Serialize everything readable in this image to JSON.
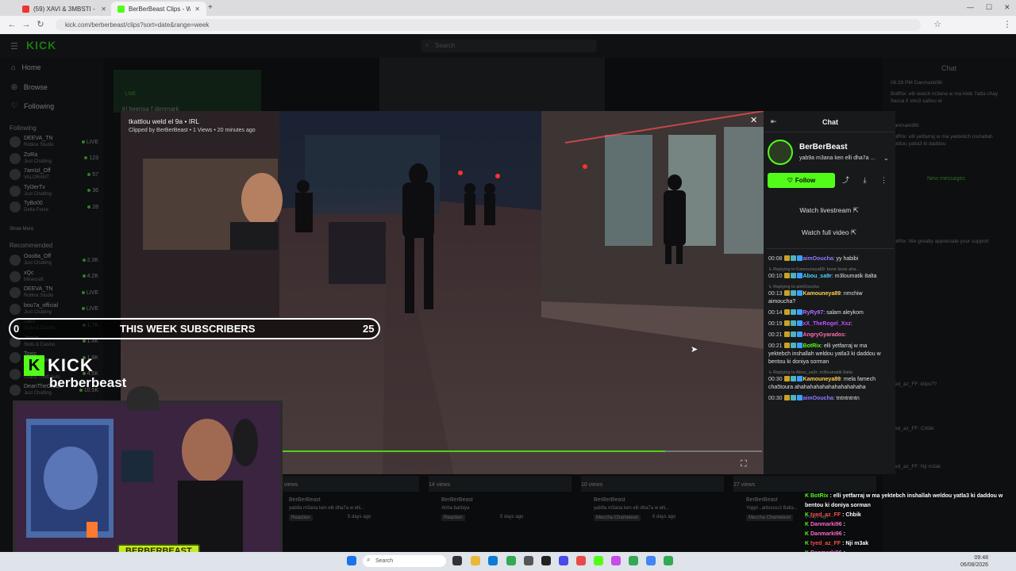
{
  "browser": {
    "tabs": [
      {
        "label": "(59) XAVI & 3MBSTI - OKI (Offic..."
      },
      {
        "label": "BerBerBeast Clips - Watch ..."
      }
    ],
    "url": "kick.com/berberbeast/clips?sort=date&range=week"
  },
  "kick": {
    "logo": "KICK",
    "search_placeholder": "Search",
    "sidebar": {
      "nav": [
        {
          "icon": "home-icon",
          "label": "Home"
        },
        {
          "icon": "compass-icon",
          "label": "Browse"
        },
        {
          "icon": "heart-icon",
          "label": "Following"
        }
      ],
      "following_title": "Following",
      "following": [
        {
          "name": "DEEVA_TN",
          "sub": "Roblox Studio",
          "count": "LIVE"
        },
        {
          "name": "ZoRa",
          "sub": "Just Chatting",
          "count": "123"
        },
        {
          "name": "7amIzl_Off",
          "sub": "VALORANT",
          "count": "57"
        },
        {
          "name": "Tyl3erTv",
          "sub": "Just Chatting",
          "count": "36"
        },
        {
          "name": "TyBo00",
          "sub": "Delta Force",
          "count": "28"
        }
      ],
      "show_more": "Show More",
      "recommended_title": "Recommended",
      "recommended": [
        {
          "name": "Ooo8a_Off",
          "sub": "Just Chatting",
          "count": "2.3K"
        },
        {
          "name": "xQc",
          "sub": "Minecraft",
          "count": "4.2K"
        },
        {
          "name": "DEEVA_TN",
          "sub": "Roblox Studio",
          "count": "LIVE"
        },
        {
          "name": "bou7a_official",
          "sub": "Just Chatting",
          "count": "LIVE"
        },
        {
          "name": "Sam",
          "sub": "Slots & Casino",
          "count": "1.7K"
        },
        {
          "name": "Jamie",
          "sub": "Slots & Casino",
          "count": "1.4K"
        },
        {
          "name": "Toxic",
          "sub": "Just Chatting",
          "count": "1.9K"
        },
        {
          "name": "Ovie",
          "sub": "Grand Theft Auto",
          "count": "4.5K"
        },
        {
          "name": "DeanTheGreat",
          "sub": "Just Chatting",
          "count": "10.5K"
        }
      ]
    },
    "bg_card": {
      "live_badge": "LIVE",
      "title": "lri twensa f denmark"
    },
    "right_chat": {
      "title": "Chat",
      "new_messages": "New messages"
    },
    "clips_row": [
      {
        "views": "17 views",
        "author": "BerBerBeast",
        "title": "yab9a m3ana ken elli dha7a w elli...",
        "tag": "Reaction",
        "age": "5 days ago"
      },
      {
        "views": "14 views",
        "author": "BerBerBeast",
        "title": "Ahha barbiya",
        "tag": "Reaction",
        "age": "5 days ago"
      },
      {
        "views": "10 views",
        "author": "BerBerBeast",
        "title": "yab9a m3ana ken elli dha7a w elli...",
        "tag": "Meccha Chameleon",
        "age": "6 days ago"
      },
      {
        "views": "27 views",
        "author": "BerBerBeast",
        "title": "Yoppi ..arbousu3 Balla...",
        "tag": "Meccha Chameleon",
        "age": "6 days ago"
      }
    ]
  },
  "modal": {
    "clip_title": "tkattlou weld el 9a • IRL",
    "clipped_by": "Clipped by BerBerBeast • 1 Views • 20 minutes ago",
    "progress": 0.8,
    "chat_title": "Chat",
    "streamer": "BerBerBeast",
    "stream_title": "yab9a m3ana ken elli dha7a ...",
    "follow_label": "Follow",
    "watch_livestream": "Watch livestream",
    "watch_full_video": "Watch full video",
    "messages": [
      {
        "time": "00:08",
        "user": "aimOoucha",
        "user_color": "#8f7bff",
        "text": "yy habibi"
      },
      {
        "time": "00:10",
        "reply": "Replying to Kamouneya89: bone bone aha...",
        "user": "Abou_sa9r",
        "user_color": "#4fd1ff",
        "text": "m3loumatik 8alta"
      },
      {
        "time": "00:13",
        "reply": "Replying to aimOoucha:",
        "user": "Kamouneya89",
        "user_color": "#ffd14f",
        "text": "nmchiw aimoucha?"
      },
      {
        "time": "00:14",
        "user": "RyRy97",
        "user_color": "#b36bff",
        "text": "salam aleykom"
      },
      {
        "time": "00:19",
        "user": "xX_TheRogel_Xxz",
        "user_color": "#c54fff",
        "text": ""
      },
      {
        "time": "00:21",
        "user": "AngryGyarados",
        "user_color": "#ff6bb0",
        "text": ""
      },
      {
        "time": "00:21",
        "user": "BotRix",
        "user_color": "#53fc18",
        "text": "elli yetfarraj w ma yektebch inshallah weldou yatla3 ki daddou w bentou ki doniya sorman"
      },
      {
        "time": "00:30",
        "reply": "Replying to Abou_sa9r: m3loumatik 8alta",
        "user": "Kamouneya89",
        "user_color": "#ffd14f",
        "text": "mela famech cha5toura ahahahahahahahahahahaha"
      },
      {
        "time": "00:30",
        "user": "aimOoucha",
        "user_color": "#8f7bff",
        "text": "tntntntntn"
      }
    ]
  },
  "overlay": {
    "subs_count_left": "0",
    "subs_title": "THIS WEEK SUBSCRIBERS",
    "subs_count_right": "25",
    "kick_word": "KICK",
    "kick_user": "berberbeast",
    "cam_name": "BERBERBEAST",
    "chat": [
      {
        "user": "BotRix",
        "color": "#53fc18",
        "text": ": elli yetfarraj w ma yektebch inshallah weldou yatla3 ki daddou w bentou ki doniya sorman"
      },
      {
        "user": "tyed_az_FF",
        "color": "#ff5050",
        "text": ": Chbik"
      },
      {
        "user": "Danmarki96",
        "color": "#ff6bd0",
        "text": ":"
      },
      {
        "user": "Danmarki96",
        "color": "#ff6bd0",
        "text": ":"
      },
      {
        "user": "tyed_az_FF",
        "color": "#ff5050",
        "text": ": Nji m3ak"
      },
      {
        "user": "Danmarki96",
        "color": "#ff6bd0",
        "text": ":"
      }
    ]
  },
  "taskbar": {
    "search_placeholder": "Search",
    "time": "09:48",
    "date": "06/08/2026"
  }
}
